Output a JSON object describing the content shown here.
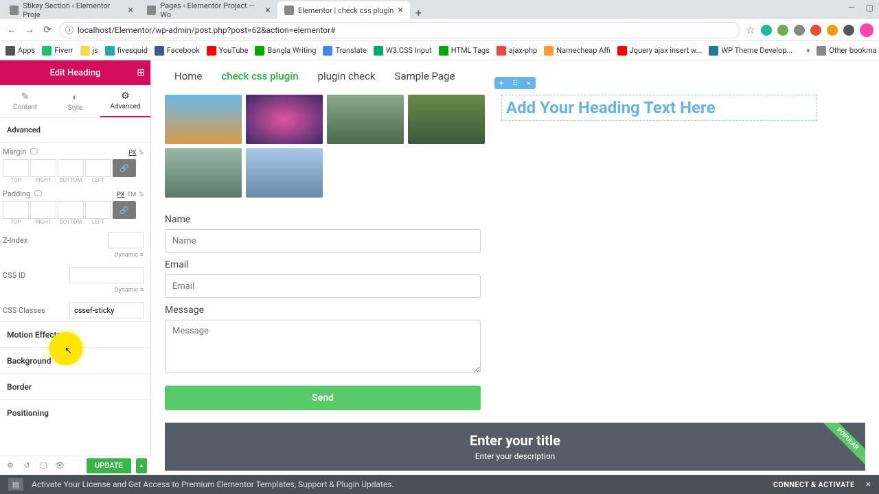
{
  "browser": {
    "tabs": [
      {
        "title": "Stikey Section ‹ Elementor Proje",
        "active": false
      },
      {
        "title": "Pages ‹ Elementor Project — Wo",
        "active": false
      },
      {
        "title": "Elementor | check css plugin",
        "active": true
      }
    ],
    "url": "localhost/Elementor/wp-admin/post.php?post=62&action=elementor#",
    "bookmarks": [
      "Apps",
      "Fiverr",
      "js",
      "fivesquid",
      "Facebook",
      "YouTube",
      "Bangla Writing",
      "Translate",
      "W3.CSS Input",
      "HTML Tags",
      "ajax-php",
      "Namecheap Affi",
      "Jquery ajax insert w...",
      "WP Theme Develop..."
    ],
    "bookmark_more": "»",
    "bookmark_other": "Other bookma"
  },
  "panel": {
    "title": "Edit Heading",
    "tabs": {
      "content": "Content",
      "style": "Style",
      "advanced": "Advanced"
    },
    "advanced": {
      "section": "Advanced",
      "margin": "Margin",
      "padding": "Padding",
      "sides": {
        "top": "TOP",
        "right": "RIGHT",
        "bottom": "BOTTOM",
        "left": "LEFT"
      },
      "units_px": "PX",
      "units_pct": "%",
      "units_em": "EM",
      "zindex": "Z-Index",
      "dynamic": "Dynamic",
      "cssid": "CSS ID",
      "cssclasses": "CSS Classes",
      "cssclasses_value": "cssef-sticky",
      "motion": "Motion Effects",
      "background": "Background",
      "border": "Border",
      "positioning": "Positioning"
    },
    "update": "UPDATE"
  },
  "canvas": {
    "menu": [
      "Home",
      "check css plugin",
      "plugin check",
      "Sample Page"
    ],
    "menu_active": 1,
    "heading_placeholder": "Add Your Heading Text Here",
    "sel_controls": {
      "add": "+",
      "drag": "⠿",
      "close": "×"
    },
    "form": {
      "name_label": "Name",
      "name_ph": "Name",
      "email_label": "Email",
      "email_ph": "Email",
      "message_label": "Message",
      "message_ph": "Message",
      "send": "Send"
    },
    "promo": {
      "title": "Enter your title",
      "desc": "Enter your description",
      "ribbon": "POPULAR"
    }
  },
  "notice": {
    "text": "Activate Your License and Get Access to Premium Elementor Templates, Support & Plugin Updates.",
    "cta": "CONNECT & ACTIVATE"
  }
}
